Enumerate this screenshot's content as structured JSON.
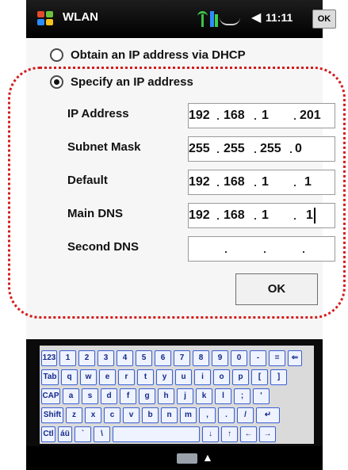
{
  "titlebar": {
    "app_title": "WLAN",
    "clock": "11:11",
    "ok_label": "OK"
  },
  "options": {
    "dhcp_label": "Obtain an IP address via DHCP",
    "static_label": "Specify an IP address",
    "selected": "static"
  },
  "fields": [
    {
      "label": "IP Address",
      "octets": [
        "192",
        "168",
        "1",
        "201"
      ]
    },
    {
      "label": "Subnet Mask",
      "octets": [
        "255",
        "255",
        "255",
        "0"
      ]
    },
    {
      "label": "Default",
      "octets": [
        "192",
        "168",
        "1",
        "1"
      ]
    },
    {
      "label": "Main DNS",
      "octets": [
        "192",
        "168",
        "1",
        "1"
      ]
    },
    {
      "label": "Second DNS",
      "octets": [
        "",
        "",
        "",
        ""
      ]
    }
  ],
  "ok_button": "OK",
  "keyboard": {
    "rows": [
      [
        "123",
        "1",
        "2",
        "3",
        "4",
        "5",
        "6",
        "7",
        "8",
        "9",
        "0",
        "-",
        "=",
        "⇐"
      ],
      [
        "Tab",
        "q",
        "w",
        "e",
        "r",
        "t",
        "y",
        "u",
        "i",
        "o",
        "p",
        "[",
        "]"
      ],
      [
        "CAP",
        "a",
        "s",
        "d",
        "f",
        "g",
        "h",
        "j",
        "k",
        "l",
        ";",
        "'"
      ],
      [
        "Shift",
        "z",
        "x",
        "c",
        "v",
        "b",
        "n",
        "m",
        ",",
        ".",
        "/",
        "↵"
      ],
      [
        "Ctl",
        "áü",
        "`",
        "\\",
        "",
        "↓",
        "↑",
        "←",
        "→"
      ]
    ]
  },
  "icons": {
    "start": "windows-logo-icon",
    "signal": "antenna-icon",
    "network": "network-icon",
    "volume": "speaker-icon",
    "sip": "keyboard-icon"
  },
  "colors": {
    "callout": "#d41b1b",
    "key_border": "#3b5fd6",
    "title_bg": "#000000"
  }
}
